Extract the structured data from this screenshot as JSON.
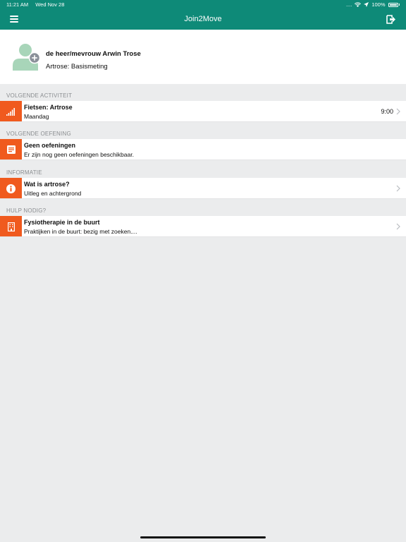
{
  "statusbar": {
    "time": "11:21 AM",
    "date": "Wed Nov 28",
    "signal": "....",
    "battery": "100%"
  },
  "navbar": {
    "title": "Join2Move",
    "menu_icon": "hamburger-menu-icon",
    "logout_icon": "logout-icon"
  },
  "profile": {
    "name": "de heer/mevrouw Arwin Trose",
    "subtitle": "Artrose: Basismeting",
    "avatar_icon": "add-user-avatar-icon"
  },
  "sections": [
    {
      "header": "VOLGENDE ACTIVITEIT",
      "item": {
        "title": "Fietsen: Artrose",
        "subtitle": "Maandag",
        "time": "9:00",
        "icon": "signal-bars-icon"
      }
    },
    {
      "header": "VOLGENDE OEFENING",
      "item": {
        "title": "Geen oefeningen",
        "subtitle": "Er zijn nog geen oefeningen beschikbaar.",
        "icon": "exercise-card-icon"
      }
    },
    {
      "header": "INFORMATIE",
      "item": {
        "title": "Wat is artrose?",
        "subtitle": "Uitleg en achtergrond",
        "icon": "info-icon"
      }
    },
    {
      "header": "HULP NODIG?",
      "item": {
        "title": "Fysiotherapie in de buurt",
        "subtitle": "Praktijken in de buurt: bezig met zoeken....",
        "icon": "building-icon"
      }
    }
  ],
  "colors": {
    "primary": "#0e8a78",
    "accent": "#f05a1e",
    "background": "#ebeced",
    "avatar": "#a8d5b9"
  }
}
